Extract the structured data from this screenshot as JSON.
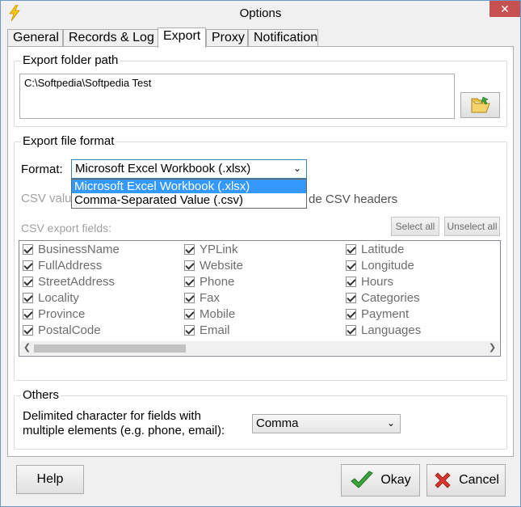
{
  "window": {
    "title": "Options",
    "close_glyph": "✕"
  },
  "tabs": [
    {
      "label": "General"
    },
    {
      "label": "Records & Log"
    },
    {
      "label": "Export"
    },
    {
      "label": "Proxy"
    },
    {
      "label": "Notification"
    }
  ],
  "export_folder": {
    "group_label": "Export folder path",
    "path": "C:\\Softpedia\\Softpedia Test"
  },
  "export_format": {
    "group_label": "Export file format",
    "format_label": "Format:",
    "selected": "Microsoft Excel Workbook (.xlsx)",
    "options": [
      "Microsoft Excel Workbook (.xlsx)",
      "Comma-Separated Value (.csv)"
    ],
    "csv_value_label_fragment": "CSV valu",
    "csv_headers_fragment": "de CSV headers",
    "csv_fields_label": "CSV export fields:",
    "select_all": "Select all",
    "unselect_all": "Unselect all",
    "fields_col1": [
      "BusinessName",
      "FullAddress",
      "StreetAddress",
      "Locality",
      "Province",
      "PostalCode"
    ],
    "fields_col2": [
      "YPLink",
      "Website",
      "Phone",
      "Fax",
      "Mobile",
      "Email"
    ],
    "fields_col3": [
      "Latitude",
      "Longitude",
      "Hours",
      "Categories",
      "Payment",
      "Languages"
    ]
  },
  "others": {
    "group_label": "Others",
    "delim_line1": "Delimited character for fields with",
    "delim_line2": "multiple elements (e.g. phone, email):",
    "delim_value": "Comma"
  },
  "buttons": {
    "help": "Help",
    "okay": "Okay",
    "cancel": "Cancel"
  },
  "colors": {
    "selection": "#3399ff",
    "close": "#c75050",
    "ok_check": "#3aa53a",
    "cancel_x": "#d9342b"
  }
}
